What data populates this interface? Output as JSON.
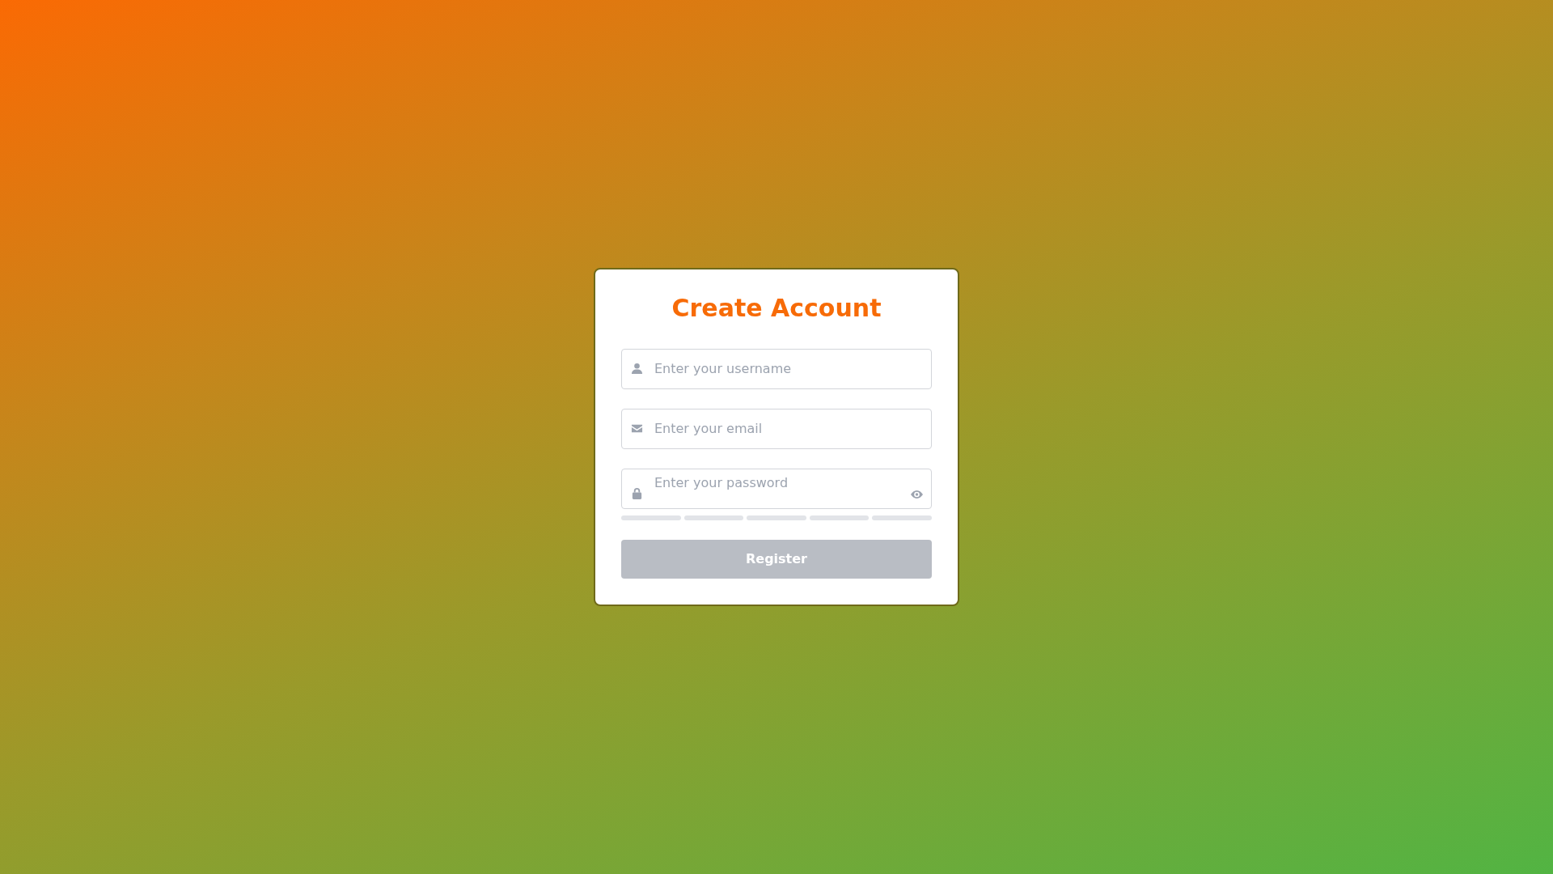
{
  "form": {
    "title": "Create Account",
    "fields": [
      {
        "kind": "username",
        "placeholder": "Enter your username"
      },
      {
        "kind": "email",
        "placeholder": "Enter your email"
      },
      {
        "kind": "password",
        "placeholder": "Enter your password"
      }
    ],
    "strength_segments": [
      {
        "filled": false
      },
      {
        "filled": false
      },
      {
        "filled": false
      },
      {
        "filled": false
      },
      {
        "filled": false
      }
    ],
    "submit": {
      "label": "Register",
      "disabled": true
    }
  }
}
